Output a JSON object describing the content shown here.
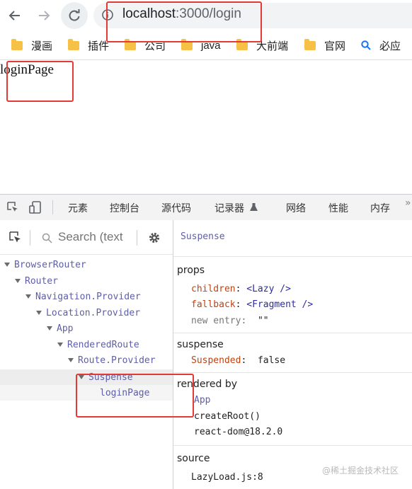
{
  "browser": {
    "url_host": "localhost",
    "url_rest": ":3000/login",
    "bookmarks": [
      "漫画",
      "插件",
      "公司",
      "java",
      "大前端",
      "官网",
      "必应"
    ]
  },
  "page": {
    "text": "loginPage"
  },
  "devtools": {
    "tabs": [
      "元素",
      "控制台",
      "源代码",
      "记录器",
      "网络",
      "性能",
      "内存"
    ],
    "search_placeholder": "Search (text",
    "tree": [
      "BrowserRouter",
      "Router",
      "Navigation.Provider",
      "Location.Provider",
      "App",
      "RenderedRoute",
      "Route.Provider",
      "Suspense",
      "loginPage"
    ],
    "selected_component": "Suspense",
    "props": {
      "title": "props",
      "children_key": "children",
      "children_val": "<Lazy />",
      "fallback_key": "fallback",
      "fallback_val": "<Fragment />",
      "new_entry_key": "new entry",
      "new_entry_val": "\"\""
    },
    "suspense": {
      "title": "suspense",
      "key": "Suspended",
      "val": "false"
    },
    "rendered_by": {
      "title": "rendered by",
      "items": [
        "App",
        "createRoot()",
        "react-dom@18.2.0"
      ]
    },
    "source": {
      "title": "source",
      "file": "LazyLoad.js:8"
    }
  },
  "watermark": "@稀土掘金技术社区",
  "colors": {
    "highlight": "#e53935",
    "component": "#5e5ea8",
    "prop_key": "#c2410c"
  }
}
